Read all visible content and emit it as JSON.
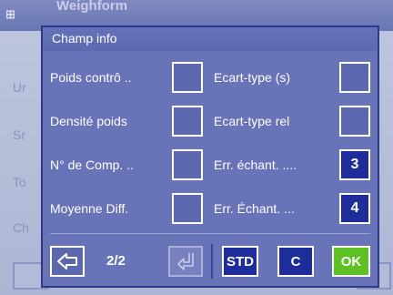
{
  "background": {
    "title": "Weighform",
    "row_letters": [
      "Ur",
      "Sr",
      "To",
      "Ch"
    ]
  },
  "dialog": {
    "title": "Champ info",
    "left_fields": [
      {
        "label": "Poids contrô  ..",
        "value": ""
      },
      {
        "label": "Densité poids",
        "value": ""
      },
      {
        "label": "N° de Comp.  ..",
        "value": ""
      },
      {
        "label": "Moyenne Diff.",
        "value": ""
      }
    ],
    "right_fields": [
      {
        "label": "Ecart-type (s)",
        "value": ""
      },
      {
        "label": "Ecart-type rel",
        "value": ""
      },
      {
        "label": "Err. échant.  ....",
        "value": "3"
      },
      {
        "label": "Err. Échant. ...",
        "value": "4"
      }
    ],
    "pagination": {
      "current_page": "2/2"
    },
    "buttons": {
      "std": "STD",
      "clear": "C",
      "ok": "OK"
    }
  },
  "colors": {
    "ok_button": "#5fc023",
    "filled_box": "#1f2d9a",
    "dialog_bg": "#6873b8"
  }
}
